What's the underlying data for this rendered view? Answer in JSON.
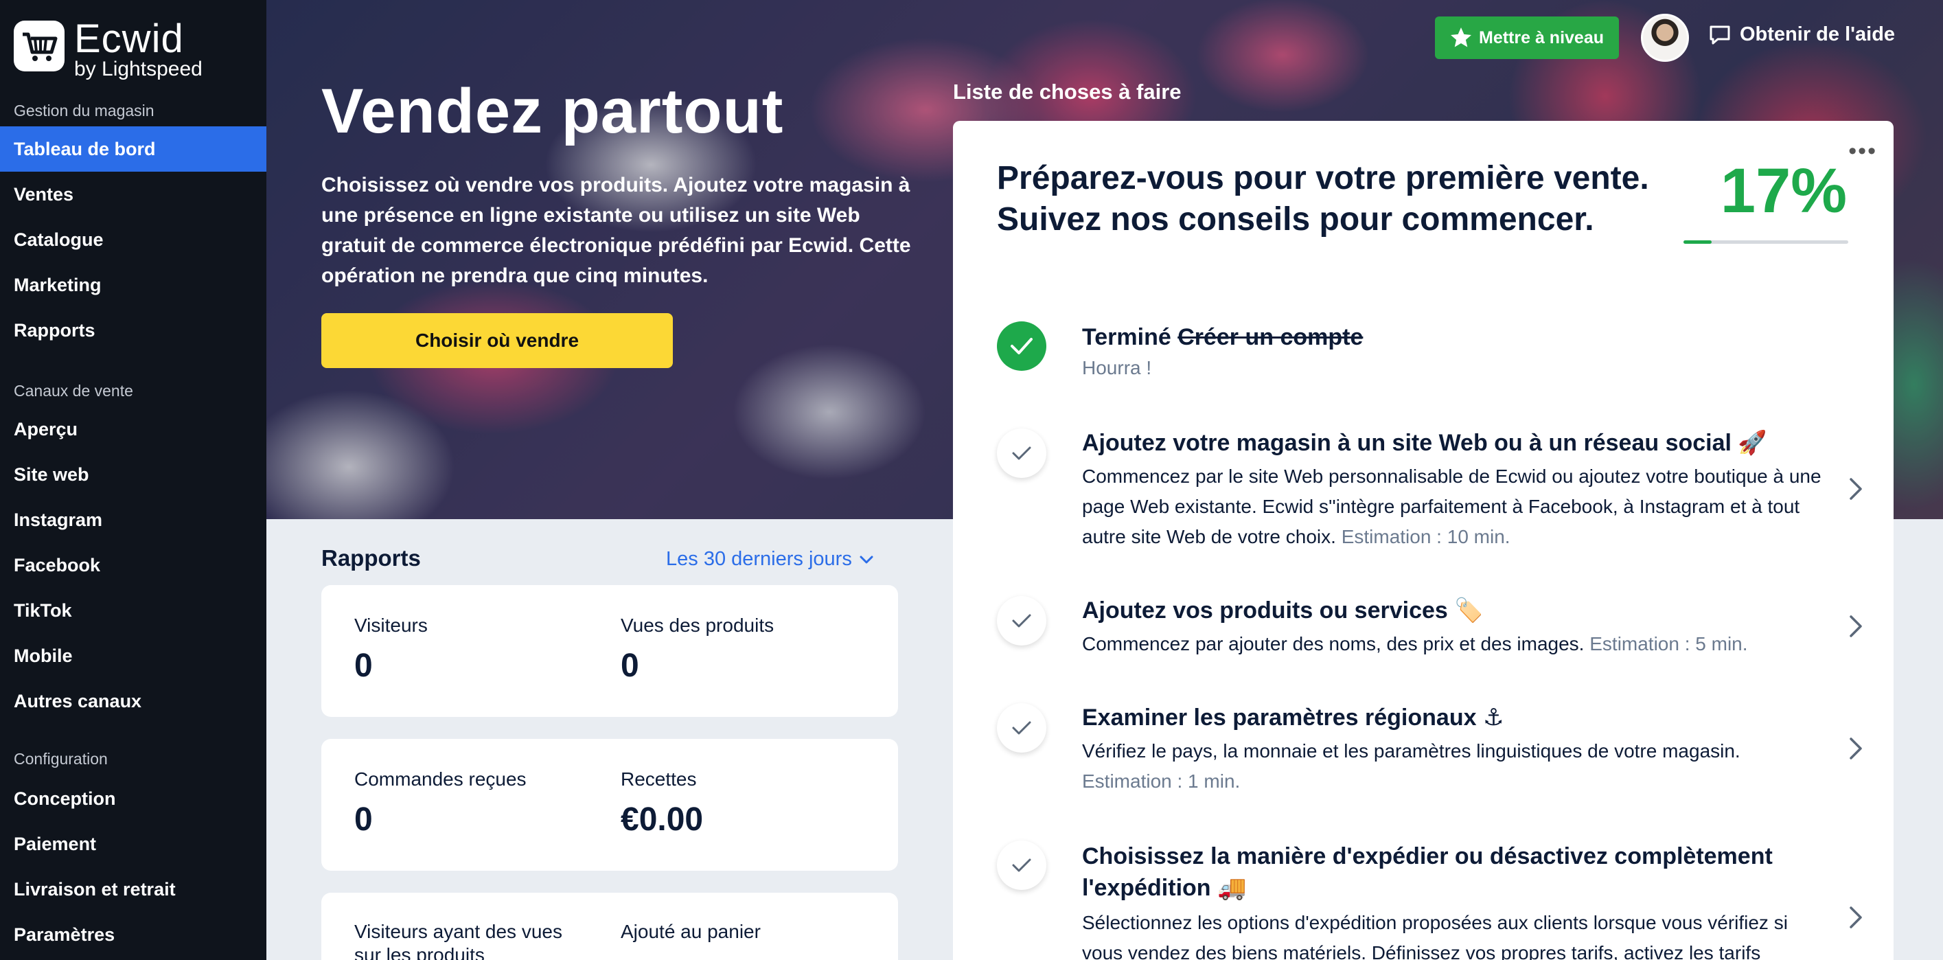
{
  "brand": {
    "name": "Ecwid",
    "sub": "by Lightspeed"
  },
  "sidebar": {
    "sections": [
      {
        "label": "Gestion du magasin"
      },
      {
        "label": "Canaux de vente"
      },
      {
        "label": "Configuration"
      }
    ],
    "items": [
      {
        "label": "Tableau de bord",
        "active": true
      },
      {
        "label": "Ventes"
      },
      {
        "label": "Catalogue"
      },
      {
        "label": "Marketing"
      },
      {
        "label": "Rapports"
      },
      {
        "label": "Aperçu"
      },
      {
        "label": "Site web"
      },
      {
        "label": "Instagram"
      },
      {
        "label": "Facebook"
      },
      {
        "label": "TikTok"
      },
      {
        "label": "Mobile"
      },
      {
        "label": "Autres canaux"
      },
      {
        "label": "Conception"
      },
      {
        "label": "Paiement"
      },
      {
        "label": "Livraison et retrait"
      },
      {
        "label": "Paramètres"
      }
    ]
  },
  "topbar": {
    "upgrade_label": "Mettre à niveau",
    "help_label": "Obtenir de l'aide"
  },
  "hero": {
    "title": "Vendez partout",
    "description": "Choisissez où vendre vos produits. Ajoutez votre magasin à une présence en ligne existante ou utilisez un site Web gratuit de commerce électronique prédéfini par Ecwid. Cette opération ne prendra que cinq minutes.",
    "button_label": "Choisir où vendre"
  },
  "todo": {
    "section_label": "Liste de choses à faire",
    "heading": "Préparez-vous pour votre première vente. Suivez nos conseils pour commencer.",
    "progress_text": "17%",
    "progress": 0.17,
    "tasks": [
      {
        "status": "Terminé",
        "title": "Créer un compte",
        "sub": "Hourra !"
      },
      {
        "title": "Ajoutez votre magasin à un site Web ou à un réseau social 🚀",
        "desc": "Commencez par le site Web personnalisable de Ecwid ou ajoutez votre boutique à une page Web existante. Ecwid s''intègre parfaitement à Facebook, à Instagram et à tout autre site Web de votre choix.",
        "estimate": "Estimation : 10 min."
      },
      {
        "title": "Ajoutez vos produits ou services 🏷️",
        "desc": "Commencez par ajouter des noms, des prix et des images.",
        "estimate": "Estimation : 5 min."
      },
      {
        "title": "Examiner les paramètres régionaux ⚓",
        "desc": "Vérifiez le pays, la monnaie et les paramètres linguistiques de votre magasin.",
        "estimate": "Estimation : 1 min."
      },
      {
        "title": "Choisissez la manière d'expédier ou désactivez complètement l'expédition 🚚",
        "desc": "Sélectionnez les options d'expédition proposées aux clients lorsque vous vérifiez si vous vendez des biens matériels. Définissez vos propres tarifs, activez les tarifs"
      }
    ]
  },
  "reports": {
    "title": "Rapports",
    "range": "Les 30 derniers jours",
    "cards": [
      {
        "metrics": [
          {
            "label": "Visiteurs",
            "value": "0"
          },
          {
            "label": "Vues des produits",
            "value": "0"
          }
        ]
      },
      {
        "metrics": [
          {
            "label": "Commandes reçues",
            "value": "0"
          },
          {
            "label": "Recettes",
            "value": "€0.00"
          }
        ]
      },
      {
        "metrics": [
          {
            "label": "Visiteurs ayant des vues sur les produits",
            "value": ""
          },
          {
            "label": "Ajouté au panier",
            "value": ""
          }
        ]
      }
    ]
  },
  "colors": {
    "accent": "#2b6de8",
    "sidebar_bg": "#0f141c",
    "upgrade": "#28a745",
    "progress": "#1ea94b",
    "cta": "#fcd835"
  }
}
